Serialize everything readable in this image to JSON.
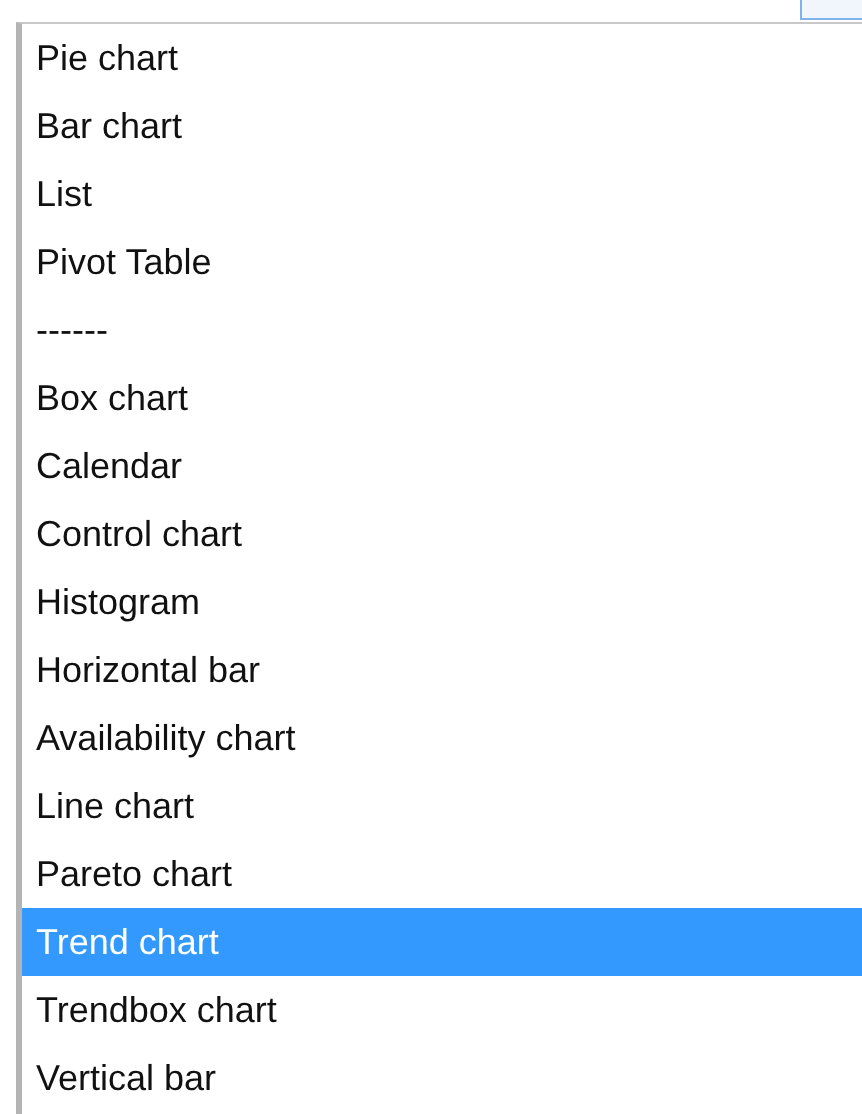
{
  "list": {
    "items": [
      {
        "label": "Pie chart",
        "selected": false
      },
      {
        "label": "Bar chart",
        "selected": false
      },
      {
        "label": "List",
        "selected": false
      },
      {
        "label": "Pivot Table",
        "selected": false
      },
      {
        "label": "------",
        "selected": false
      },
      {
        "label": "Box chart",
        "selected": false
      },
      {
        "label": "Calendar",
        "selected": false
      },
      {
        "label": "Control chart",
        "selected": false
      },
      {
        "label": "Histogram",
        "selected": false
      },
      {
        "label": "Horizontal bar",
        "selected": false
      },
      {
        "label": "Availability chart",
        "selected": false
      },
      {
        "label": "Line chart",
        "selected": false
      },
      {
        "label": "Pareto chart",
        "selected": false
      },
      {
        "label": "Trend chart",
        "selected": true
      },
      {
        "label": "Trendbox chart",
        "selected": false
      },
      {
        "label": "Vertical bar",
        "selected": false
      }
    ]
  }
}
